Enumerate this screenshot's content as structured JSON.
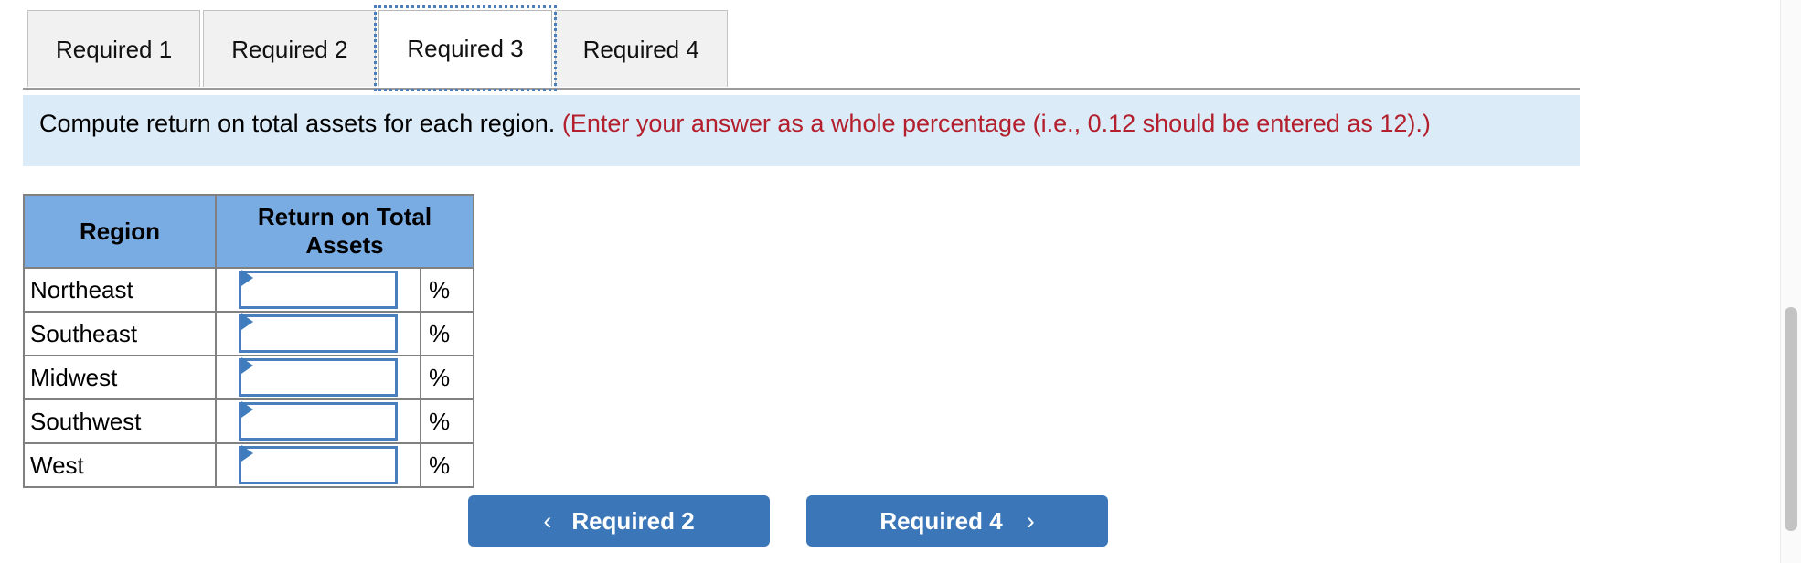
{
  "tabs": [
    {
      "label": "Required 1",
      "active": false
    },
    {
      "label": "Required 2",
      "active": false
    },
    {
      "label": "Required 3",
      "active": true
    },
    {
      "label": "Required 4",
      "active": false
    }
  ],
  "instruction": {
    "prompt": "Compute return on total assets for each region. ",
    "hint": "(Enter your answer as a whole percentage (i.e., 0.12 should be entered as 12).)"
  },
  "table": {
    "headers": [
      "Region",
      "Return on Total Assets"
    ],
    "unit_suffix": "%",
    "rows": [
      {
        "region": "Northeast",
        "value": "",
        "placeholder": ""
      },
      {
        "region": "Southeast",
        "value": "",
        "placeholder": ""
      },
      {
        "region": "Midwest",
        "value": "",
        "placeholder": ""
      },
      {
        "region": "Southwest",
        "value": "",
        "placeholder": ""
      },
      {
        "region": "West",
        "value": "",
        "placeholder": ""
      }
    ]
  },
  "nav": {
    "prev_label": "Required 2",
    "next_label": "Required 4",
    "prev_chevron": "‹",
    "next_chevron": "›"
  },
  "colors": {
    "header_blue": "#7aace4",
    "banner_blue": "#dcebf8",
    "hint_red": "#b31f2c",
    "button_blue": "#3b77b8",
    "field_border": "#4a7fbe"
  }
}
